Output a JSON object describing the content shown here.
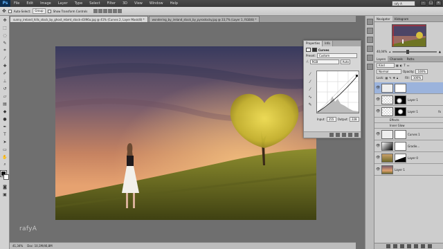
{
  "app": {
    "logo": "Ps",
    "profile": "rafy A"
  },
  "menu": [
    "File",
    "Edit",
    "Image",
    "Layer",
    "Type",
    "Select",
    "Filter",
    "3D",
    "View",
    "Window",
    "Help"
  ],
  "window_controls": [
    "–",
    "□",
    "✕"
  ],
  "options": {
    "auto_select": "Auto-Select:",
    "auto_select_value": "Group",
    "show_transform": "Show Transform Controls"
  },
  "tabs": [
    {
      "label": "sunny_ireland_hills_stock_by_ghost_mbmt_stock-d3l96a.jpg @ 41% (Curves 2, Layer Mask/8) *"
    },
    {
      "label": "wondering_by_ireland_stock_by_pyrostocky.jpg @ 33,7% (Layer 1, RGB/8) *"
    }
  ],
  "status": {
    "zoom": "41,34%",
    "doc": "Doc: 10,1M/46,8M"
  },
  "watermark": "rafyA",
  "properties": {
    "tabs": [
      "Properties",
      "Info"
    ],
    "title": "Curves",
    "preset_label": "Preset:",
    "preset_value": "Custom",
    "channel": "RGB",
    "auto": "Auto",
    "input_label": "Input:",
    "input_value": "255",
    "output_label": "Output:",
    "output_value": "228"
  },
  "navigator": {
    "tabs": [
      "Navigator",
      "Histogram"
    ],
    "zoom": "40,04%"
  },
  "layers_panel": {
    "tabs": [
      "Layers",
      "Channels",
      "Paths"
    ],
    "kind": "Kind",
    "blend": "Normal",
    "opacity_label": "Opacity:",
    "opacity": "100%",
    "lock_label": "Lock:",
    "fill_label": "Fill:",
    "fill": "100%",
    "layers": [
      {
        "name": "",
        "selected": true,
        "type": "adjustment"
      },
      {
        "name": "Layer 1",
        "selected": false,
        "type": "masked"
      },
      {
        "name": "Layer 1",
        "selected": false,
        "type": "fx"
      },
      {
        "name": "Effects",
        "selected": false,
        "type": "sub"
      },
      {
        "name": "Inner Glow",
        "selected": false,
        "type": "sub"
      },
      {
        "name": "Curves 1",
        "selected": false,
        "type": "adjustment"
      },
      {
        "name": "Gradie...",
        "selected": false,
        "type": "gradient"
      },
      {
        "name": "Layer 0",
        "selected": false,
        "type": "photo"
      },
      {
        "name": "Layer 1",
        "selected": false,
        "type": "photo2"
      }
    ]
  },
  "colors": {
    "accent": "#9bb3dc",
    "sky_top": "#3d3f63",
    "sky_mid": "#b27a60",
    "sky_glow": "#e7a876",
    "grass": "#707a22",
    "tree": "#d7c53e"
  }
}
